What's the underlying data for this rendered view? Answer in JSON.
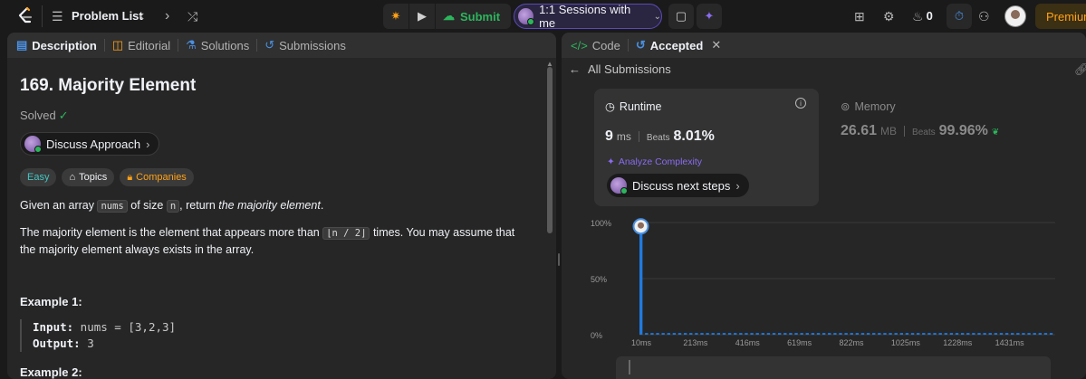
{
  "topbar": {
    "problem_list": "Problem List",
    "submit": "Submit",
    "sessions": "1:1 Sessions with me",
    "streak": "0",
    "premium": "Premium"
  },
  "left": {
    "tabs": [
      {
        "label": "Description",
        "icon": "description-icon"
      },
      {
        "label": "Editorial",
        "icon": "book-icon"
      },
      {
        "label": "Solutions",
        "icon": "flask-icon"
      },
      {
        "label": "Submissions",
        "icon": "history-icon"
      }
    ],
    "title": "169. Majority Element",
    "solved": "Solved",
    "discuss": "Discuss Approach",
    "tags": {
      "difficulty": "Easy",
      "topics": "Topics",
      "companies": "Companies"
    },
    "p1": {
      "a": "Given an array ",
      "code1": "nums",
      "b": " of size ",
      "code2": "n",
      "c": ", return ",
      "em": "the majority element",
      "d": "."
    },
    "p2": {
      "a": "The majority element is the element that appears more than ",
      "code": "⌊n / 2⌋",
      "b": " times. You may assume that the majority element always exists in the array."
    },
    "example1": {
      "title": "Example 1:",
      "input_label": "Input:",
      "input": " nums = [3,2,3]",
      "output_label": "Output:",
      "output": " 3"
    },
    "example2": {
      "title": "Example 2:"
    }
  },
  "right": {
    "tabs": {
      "code": "Code",
      "accepted": "Accepted"
    },
    "back": "All Submissions",
    "runtime": {
      "title": "Runtime",
      "value": "9",
      "unit": "ms",
      "beats_label": "Beats",
      "beats": "8.01%"
    },
    "analyze": "Analyze Complexity",
    "discuss_next": "Discuss next steps",
    "memory": {
      "title": "Memory",
      "value": "26.61",
      "unit": "MB",
      "beats_label": "Beats",
      "beats": "99.96%"
    }
  },
  "colors": {
    "accent": "#4a90e2",
    "green": "#2db55d",
    "orange": "#ffa116",
    "purple": "#8a6cf0"
  },
  "chart_data": {
    "type": "bar",
    "categories": [
      "10ms",
      "213ms",
      "416ms",
      "619ms",
      "822ms",
      "1025ms",
      "1228ms",
      "1431ms"
    ],
    "ytick_labels": [
      "100%",
      "50%",
      "0%"
    ],
    "ylim": [
      0,
      100
    ],
    "values": [
      95,
      1.5,
      1.5,
      1.5,
      1.5,
      1.5,
      1.5,
      1.5,
      1.5,
      1.5,
      1.5,
      1.5,
      1.5,
      1.5,
      1.5,
      1.5,
      1.5,
      1.5,
      1.5,
      1.5,
      1.5,
      1.5,
      1.5,
      1.5,
      1.5,
      1.5,
      1.5,
      1.5,
      1.5,
      1.5,
      1.5,
      1.5,
      1.5,
      1.5,
      1.5,
      1.5,
      1.5,
      1.5,
      1.5,
      1.5,
      1.5,
      1.5,
      1.5,
      1.5,
      1.5,
      1.5,
      1.5,
      1.5,
      1.5,
      1.5,
      1.5,
      1.5,
      1.5,
      1.5,
      1.5,
      1.5,
      1.5,
      1.5,
      1.5,
      1.5,
      1.5,
      1.5,
      1.5,
      1.5,
      1.5,
      1.5,
      1.5,
      1.5,
      1.5,
      1.5,
      1.5,
      1.5,
      1.5,
      1.5,
      1.5
    ],
    "grid": true,
    "bar_color": "#1f7ae0"
  }
}
